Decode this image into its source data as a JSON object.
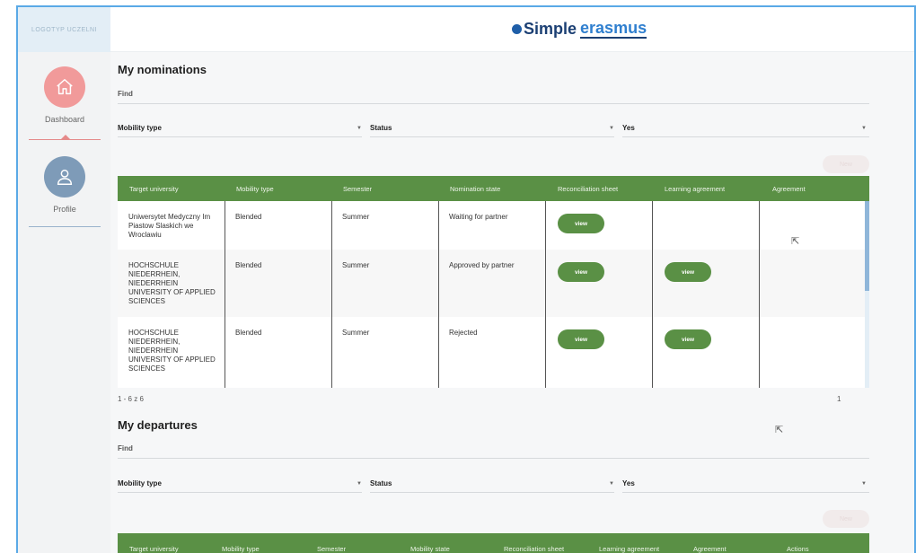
{
  "header": {
    "logo_text": "LOGOTYP UCZELNI",
    "brand_simple": "Simple",
    "brand_erasmus": "erasmus"
  },
  "sidebar": {
    "items": [
      {
        "label": "Dashboard",
        "icon": "home-icon"
      },
      {
        "label": "Profile",
        "icon": "user-icon"
      }
    ]
  },
  "nominations": {
    "title": "My nominations",
    "find_label": "Find",
    "filters": {
      "mobility_type": "Mobility type",
      "status": "Status",
      "yes": "Yes"
    },
    "ghost_button": "New",
    "columns": [
      "Target university",
      "Mobility type",
      "Semester",
      "Nomination state",
      "Reconciliation sheet",
      "Learning agreement",
      "Agreement"
    ],
    "rows": [
      {
        "university": "Uniwersytet Medyczny Im Piastow Slaskich we Wroclawiu",
        "mobility": "Blended",
        "semester": "Summer",
        "state": "Waiting for partner",
        "reconciliation": "view",
        "learning": "",
        "agreement": ""
      },
      {
        "university": "HOCHSCHULE NIEDERRHEIN, NIEDERRHEIN UNIVERSITY OF APPLIED SCIENCES",
        "mobility": "Blended",
        "semester": "Summer",
        "state": "Approved by partner",
        "reconciliation": "view",
        "learning": "view",
        "agreement": ""
      },
      {
        "university": "HOCHSCHULE NIEDERRHEIN, NIEDERRHEIN UNIVERSITY OF APPLIED SCIENCES",
        "mobility": "Blended",
        "semester": "Summer",
        "state": "Rejected",
        "reconciliation": "view",
        "learning": "view",
        "agreement": ""
      }
    ],
    "pagination": {
      "range": "1 - 6 z 6",
      "page": "1"
    }
  },
  "departures": {
    "title": "My departures",
    "find_label": "Find",
    "filters": {
      "mobility_type": "Mobility type",
      "status": "Status",
      "yes": "Yes"
    },
    "ghost_button": "New",
    "columns": [
      "Target university",
      "Mobility type",
      "Semester",
      "Mobility state",
      "Reconciliation sheet",
      "Learning agreement",
      "Agreement",
      "Actions"
    ]
  },
  "colors": {
    "accent_green": "#5a9045",
    "dashboard_pink": "#f19a9a",
    "profile_blue": "#7e9bb8",
    "frame_blue": "#5aa9e6"
  }
}
